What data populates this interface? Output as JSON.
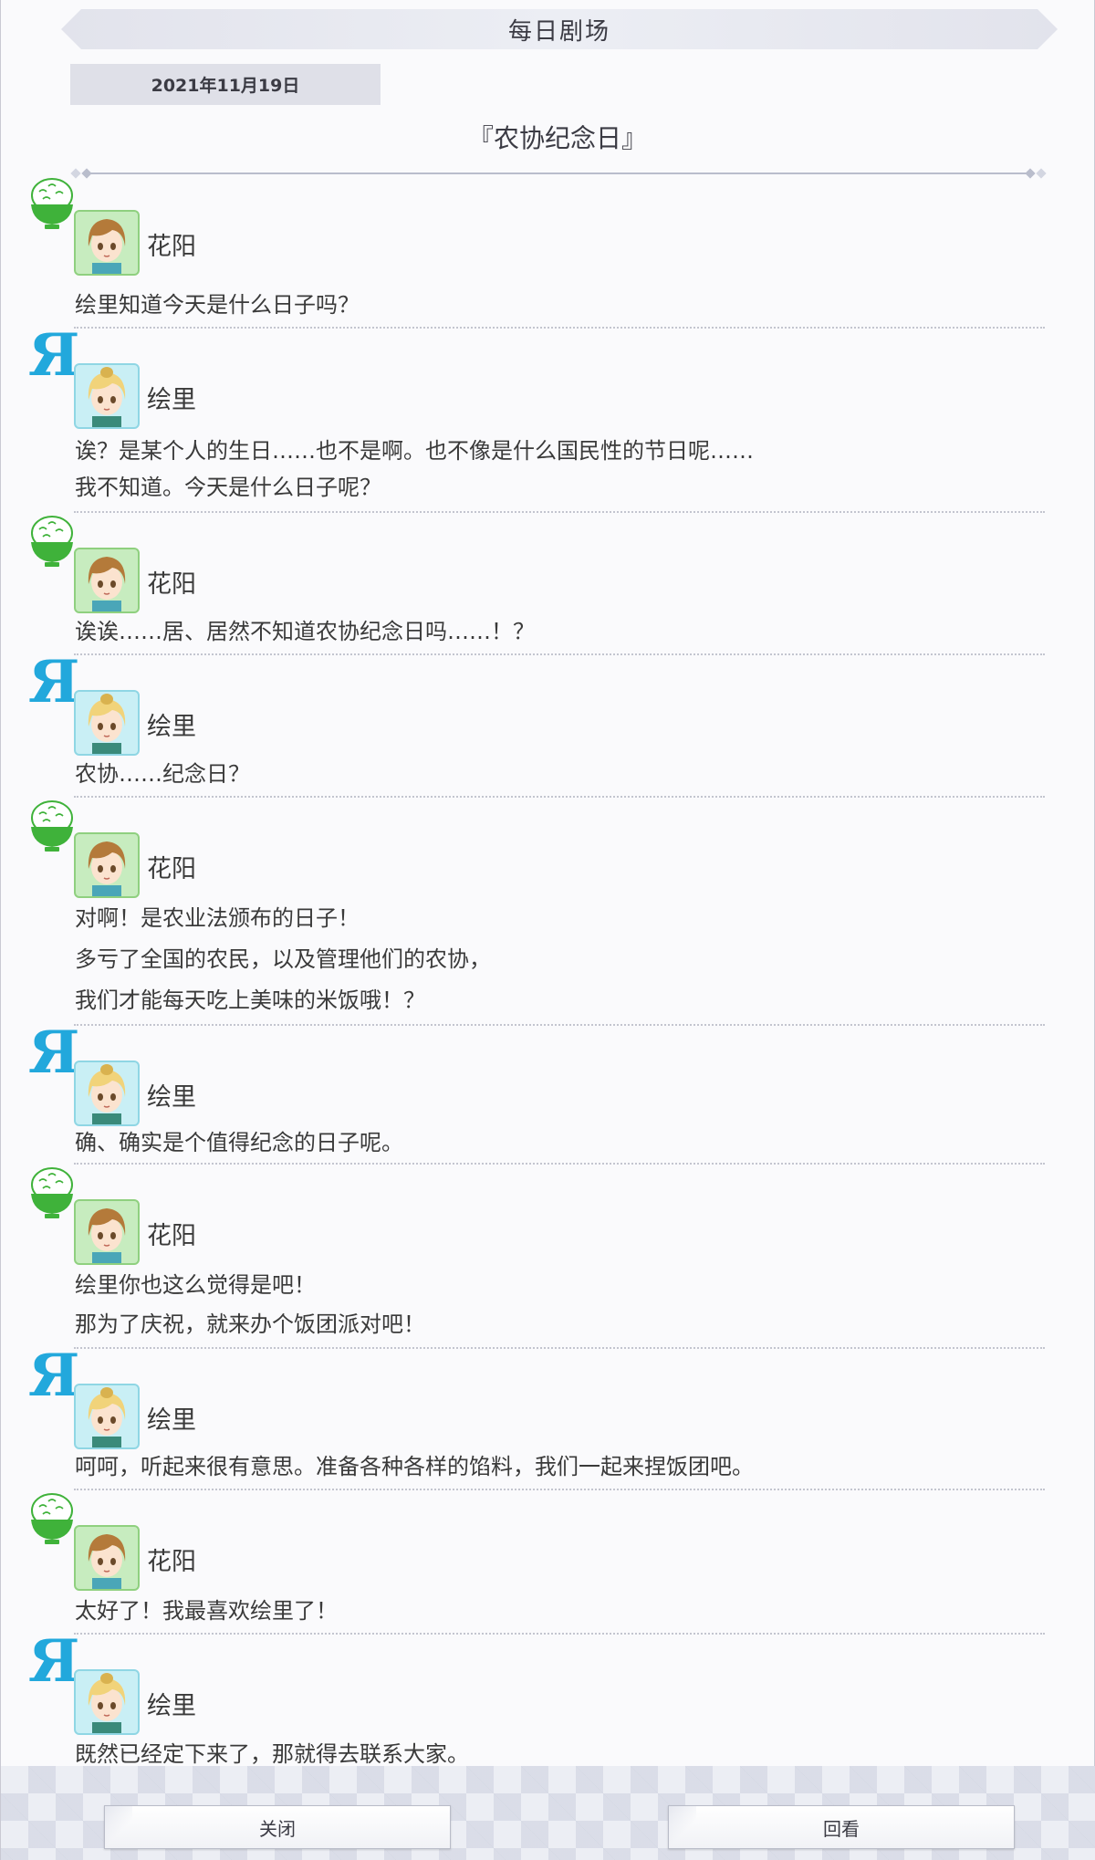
{
  "header": {
    "title": "每日剧场"
  },
  "date": "2021年11月19日",
  "story_title": "『农协纪念日』",
  "messages": [
    {
      "speaker": "花阳",
      "lines": [
        "绘里知道今天是什么日子吗？"
      ]
    },
    {
      "speaker": "绘里",
      "lines": [
        "诶？是某个人的生日……也不是啊。也不像是什么国民性的节日呢……",
        "我不知道。今天是什么日子呢？"
      ]
    },
    {
      "speaker": "花阳",
      "lines": [
        "诶诶……居、居然不知道农协纪念日吗……！？"
      ]
    },
    {
      "speaker": "绘里",
      "lines": [
        "农协……纪念日？"
      ]
    },
    {
      "speaker": "花阳",
      "lines": [
        "对啊！是农业法颁布的日子！",
        "多亏了全国的农民，以及管理他们的农协，",
        "我们才能每天吃上美味的米饭哦！？"
      ]
    },
    {
      "speaker": "绘里",
      "lines": [
        "确、确实是个值得纪念的日子呢。"
      ]
    },
    {
      "speaker": "花阳",
      "lines": [
        "绘里你也这么觉得是吧！",
        "那为了庆祝，就来办个饭团派对吧！"
      ]
    },
    {
      "speaker": "绘里",
      "lines": [
        "呵呵，听起来很有意思。准备各种各样的馅料，我们一起来捏饭团吧。"
      ]
    },
    {
      "speaker": "花阳",
      "lines": [
        "太好了！我最喜欢绘里了！"
      ]
    },
    {
      "speaker": "绘里",
      "lines": [
        "既然已经定下来了，那就得去联系大家。"
      ]
    }
  ],
  "emblem_letter": "Я",
  "buttons": {
    "close": "关闭",
    "replay": "回看"
  },
  "colors": {
    "hanayo": "#3fb23a",
    "eli": "#22a8dc"
  }
}
